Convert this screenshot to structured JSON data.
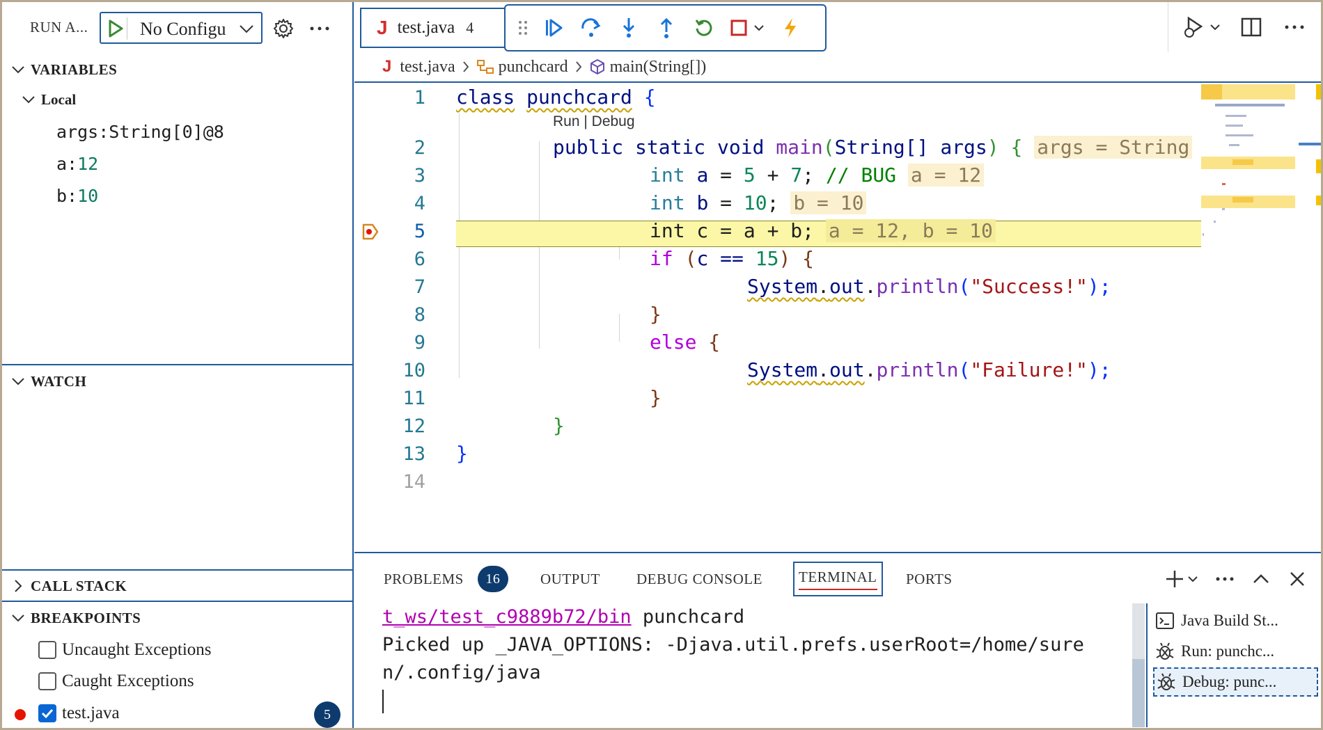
{
  "sidebar": {
    "run_title": "RUN A...",
    "config_label": "No Configu",
    "variables": {
      "title": "VARIABLES",
      "local_title": "Local",
      "items": [
        {
          "name": "args: ",
          "value": "String[0]@8"
        },
        {
          "name": "a: ",
          "value": "12"
        },
        {
          "name": "b: ",
          "value": "10"
        }
      ]
    },
    "watch_title": "WATCH",
    "callstack_title": "CALL STACK",
    "breakpoints": {
      "title": "BREAKPOINTS",
      "items": [
        {
          "label": "Uncaught Exceptions",
          "checked": false
        },
        {
          "label": "Caught Exceptions",
          "checked": false
        },
        {
          "label": "test.java",
          "checked": true
        }
      ],
      "count": "5"
    }
  },
  "editor": {
    "tab": {
      "label": "test.java",
      "count": "4"
    },
    "breadcrumb": [
      "test.java",
      "punchcard",
      "main(String[])"
    ],
    "codelens": "Run | Debug",
    "line_numbers": [
      "1",
      "2",
      "3",
      "4",
      "5",
      "6",
      "7",
      "8",
      "9",
      "10",
      "11",
      "12",
      "13",
      "14"
    ],
    "current_line": "5",
    "inlays": {
      "l2": "args = String",
      "l3": "a = 12",
      "l4": "b = 10",
      "l5": "a = 12, b = 10"
    },
    "code": {
      "l1": {
        "kw": "class",
        "name": "punchcard",
        "brace": "{"
      },
      "l2": {
        "mods": "public static void",
        "fn": "main",
        "open": "(",
        "type": "String[]",
        "arg": "args",
        "close": ")",
        "brace": "{"
      },
      "l3": {
        "type": "int",
        "var": "a",
        "eq": " = ",
        "n1": "5",
        "plus": " + ",
        "n2": "7",
        "semi": "; ",
        "comment": "// BUG"
      },
      "l4": {
        "type": "int",
        "var": "b",
        "eq": " = ",
        "n1": "10",
        "semi": ";"
      },
      "l5": {
        "text": "int c = a + b;"
      },
      "l6": {
        "kw": "if",
        "open": " (",
        "cond": "c == ",
        "n": "15",
        "close": ") ",
        "brace": "{"
      },
      "l7": {
        "obj": "System",
        "dot1": ".",
        "field": "out",
        "dot2": ".",
        "fn": "println",
        "open": "(",
        "str": "\"Success!\"",
        "close": ");"
      },
      "l8": {
        "brace": "}"
      },
      "l9": {
        "kw": "else",
        "brace": " {"
      },
      "l10": {
        "obj": "System",
        "dot1": ".",
        "field": "out",
        "dot2": ".",
        "fn": "println",
        "open": "(",
        "str": "\"Failure!\"",
        "close": ");"
      },
      "l11": {
        "brace": "}"
      },
      "l12": {
        "brace": "}"
      },
      "l13": {
        "brace": "}"
      }
    }
  },
  "panel": {
    "tabs": [
      "PROBLEMS",
      "OUTPUT",
      "DEBUG CONSOLE",
      "TERMINAL",
      "PORTS"
    ],
    "problems_count": "16",
    "active_tab": "TERMINAL",
    "terminal": {
      "path": "t_ws/test_c9889b72/bin",
      "cmd": " punchcard",
      "line2": "Picked up _JAVA_OPTIONS: -Djava.util.prefs.userRoot=/home/sure",
      "line3": "n/.config/java"
    },
    "terminal_list": [
      "Java Build St...",
      "Run: punchc...",
      "Debug: punc..."
    ]
  },
  "colors": {
    "accent_border": "#1f5a9c",
    "breakpoint_red": "#e51400",
    "badge_bg": "#0e3b6e",
    "current_line_bg": "#fbf7a6"
  }
}
